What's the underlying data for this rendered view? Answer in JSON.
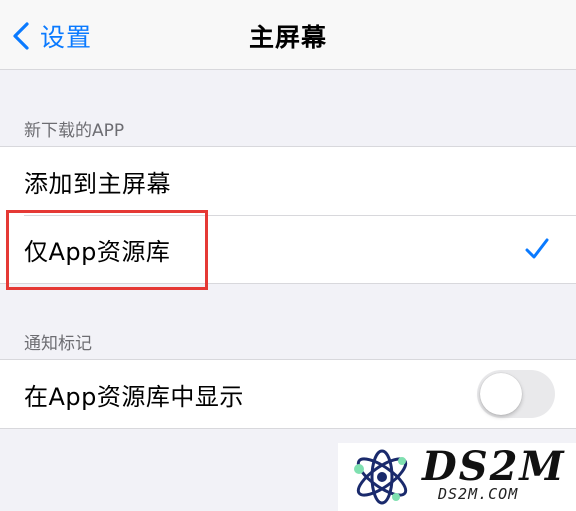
{
  "nav": {
    "back_label": "设置",
    "title": "主屏幕"
  },
  "sections": {
    "new_downloads": {
      "header": "新下载的APP",
      "options": [
        {
          "label": "添加到主屏幕",
          "selected": false
        },
        {
          "label": "仅App资源库",
          "selected": true
        }
      ]
    },
    "notification_badges": {
      "header": "通知标记",
      "toggle_label": "在App资源库中显示",
      "toggle_on": false
    }
  },
  "watermark": {
    "main": "DS2M",
    "sub": "DS2M.COM"
  },
  "colors": {
    "accent": "#0a7aff",
    "highlight_box": "#e53935",
    "background": "#f2f2f7"
  },
  "icons": {
    "back": "chevron-left-icon",
    "selected": "checkmark-icon"
  }
}
